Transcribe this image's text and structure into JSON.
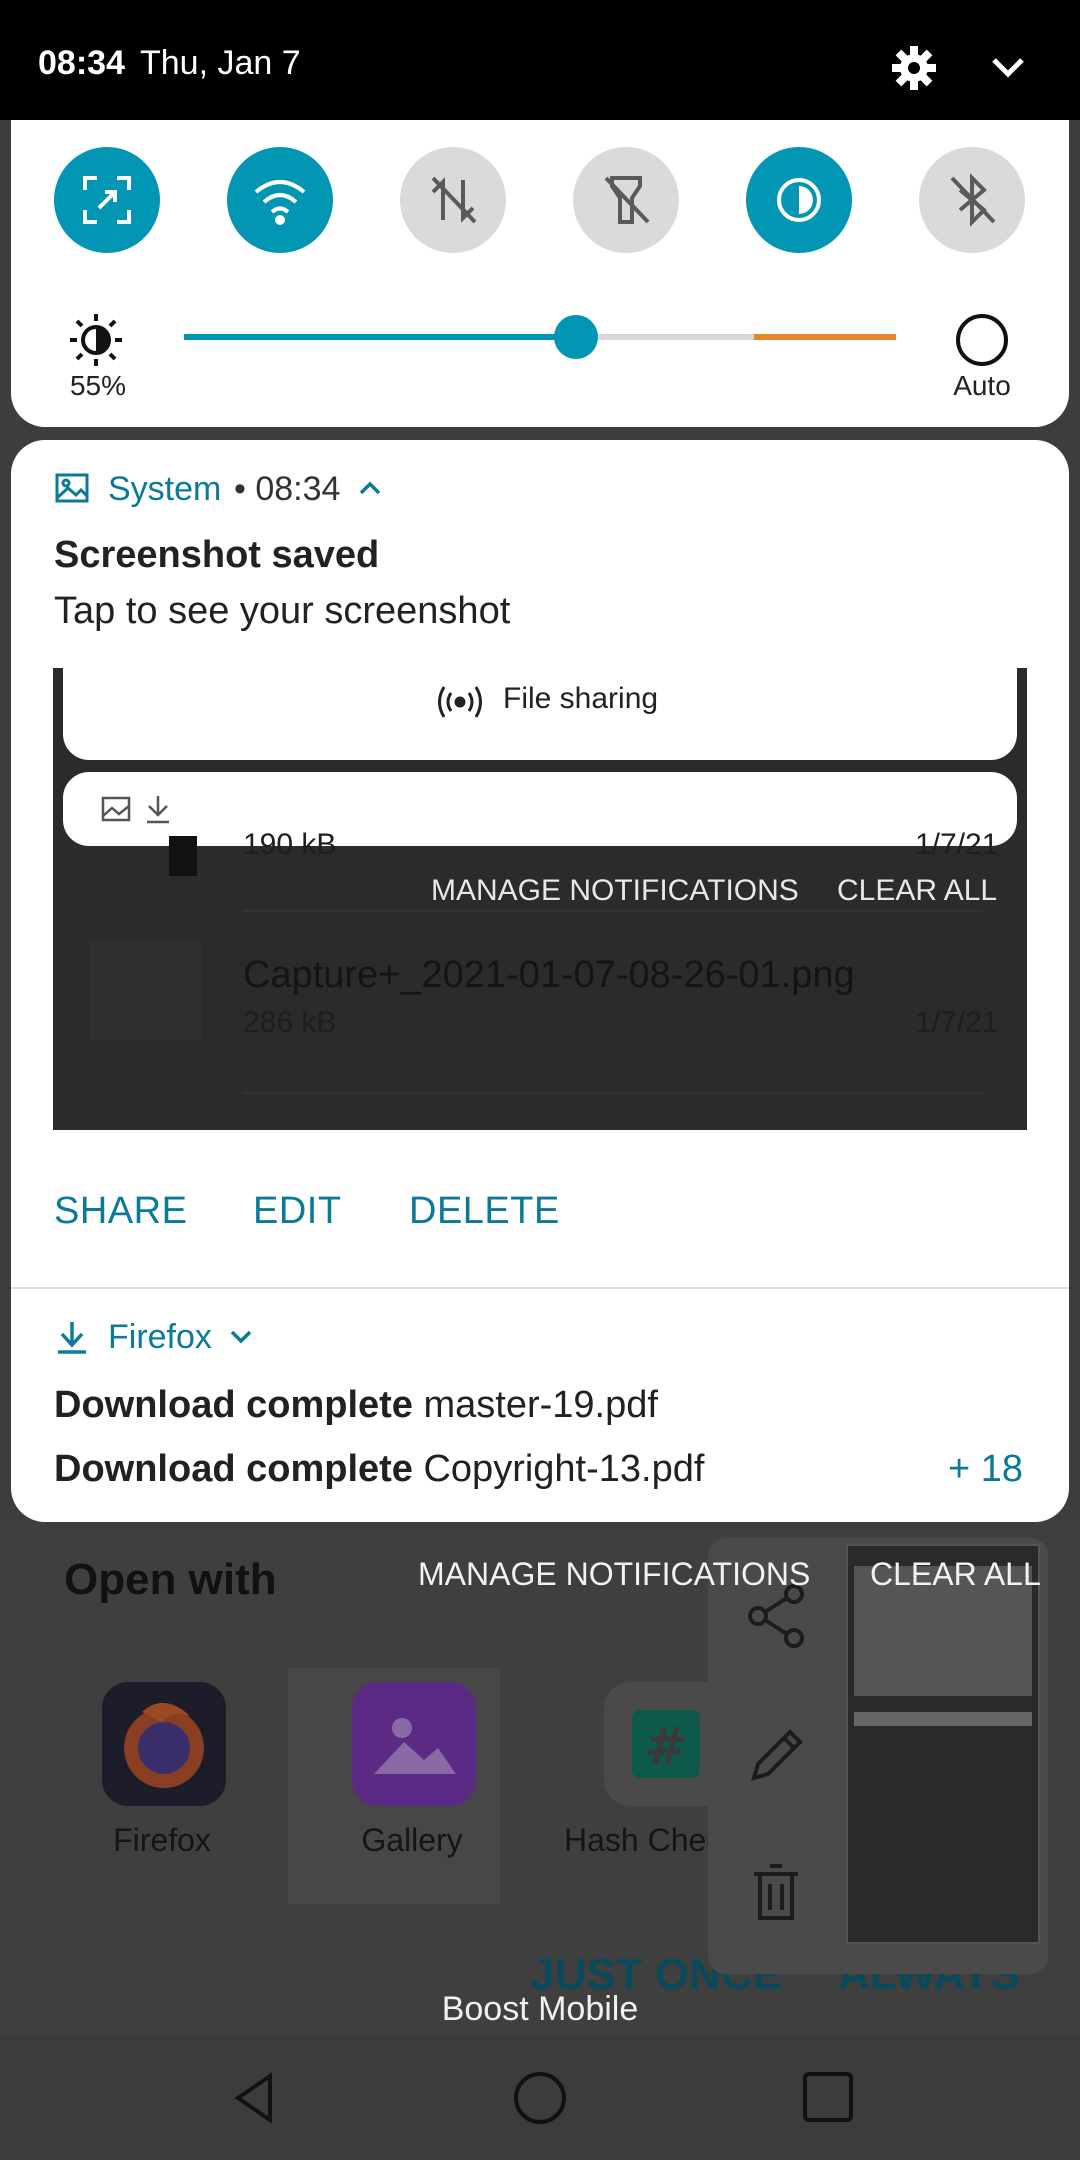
{
  "status_bar": {
    "time": "08:34",
    "date": "Thu, Jan 7"
  },
  "brightness": {
    "percent_label": "55%",
    "level": 0.55,
    "auto_label": "Auto"
  },
  "quick_tiles": [
    {
      "name": "screen-capture-icon",
      "state": "on"
    },
    {
      "name": "wifi-icon",
      "state": "on"
    },
    {
      "name": "mobile-data-icon",
      "state": "off"
    },
    {
      "name": "flashlight-icon",
      "state": "off"
    },
    {
      "name": "dark-mode-icon",
      "state": "on"
    },
    {
      "name": "bluetooth-icon",
      "state": "off"
    }
  ],
  "screenshot_notification": {
    "app": "System",
    "time": "• 08:34",
    "title": "Screenshot saved",
    "text": "Tap to see your screenshot",
    "preview": {
      "file_sharing": "File sharing",
      "size_1": "190 kB",
      "date_1": "1/7/21",
      "manage": "MANAGE NOTIFICATIONS",
      "clear": "CLEAR ALL",
      "file_name": "Capture+_2021-01-07-08-26-01.png",
      "size_2": "286 kB",
      "date_2": "1/7/21"
    },
    "actions": {
      "share": "SHARE",
      "edit": "EDIT",
      "delete": "DELETE"
    }
  },
  "firefox_notification": {
    "app": "Firefox",
    "line1_bold": "Download complete",
    "line1_file": "master-19.pdf",
    "line2_bold": "Download complete",
    "line2_file": "Copyright-13.pdf",
    "more": "+ 18"
  },
  "shade_footer": {
    "manage": "MANAGE NOTIFICATIONS",
    "clear_all": "CLEAR ALL"
  },
  "background": {
    "open_with": "Open with",
    "apps": [
      "Firefox",
      "Gallery",
      "Hash Chec"
    ],
    "just_once": "JUST ONCE",
    "always": "ALWAYS",
    "carrier": "Boost Mobile"
  },
  "colors": {
    "accent": "#0396b4",
    "orange": "#e8852c"
  }
}
